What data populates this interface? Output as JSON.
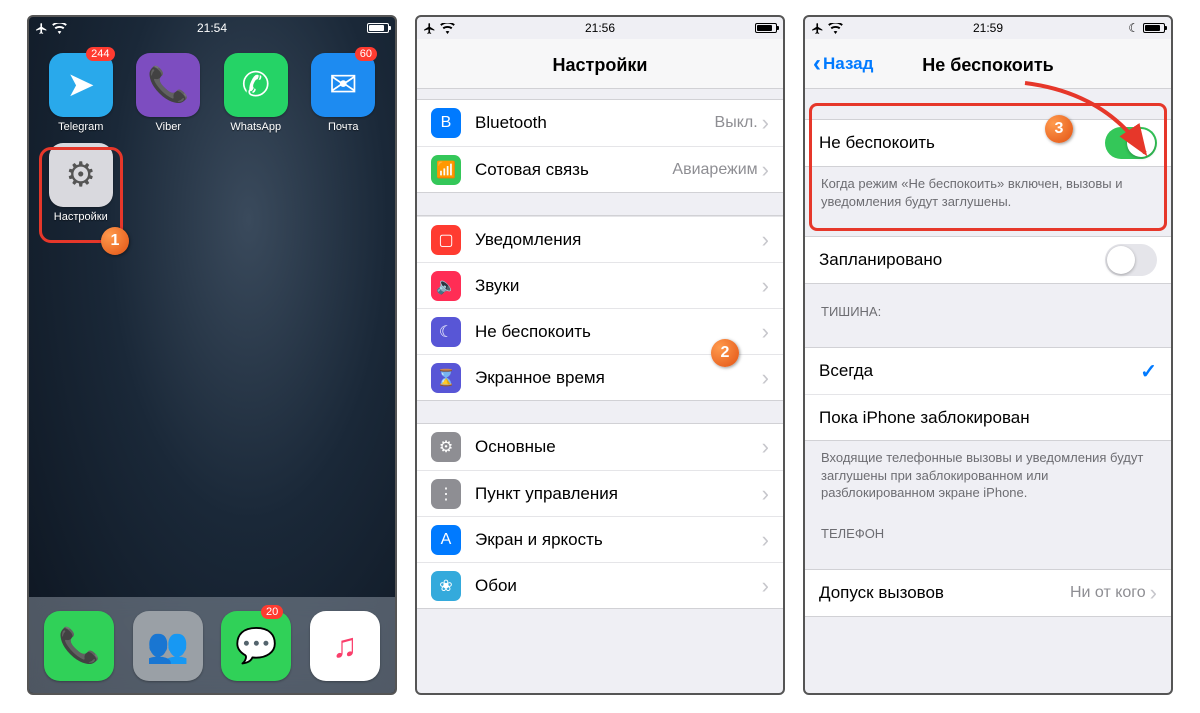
{
  "screen1": {
    "time": "21:54",
    "apps": [
      {
        "name": "telegram",
        "label": "Telegram",
        "badge": "244",
        "bg": "#29a9eb",
        "glyph": "➤"
      },
      {
        "name": "viber",
        "label": "Viber",
        "badge": null,
        "bg": "#7d4dc0",
        "glyph": "📞"
      },
      {
        "name": "whatsapp",
        "label": "WhatsApp",
        "badge": null,
        "bg": "#25d366",
        "glyph": "✆"
      },
      {
        "name": "mail",
        "label": "Почта",
        "badge": "60",
        "bg": "#1d8bf1",
        "glyph": "✉"
      },
      {
        "name": "settings",
        "label": "Настройки",
        "badge": null,
        "bg": "#d9d9de",
        "glyph": "⚙"
      }
    ],
    "dock": [
      {
        "name": "phone",
        "bg": "#30d158",
        "glyph": "📞",
        "badge": null
      },
      {
        "name": "contacts",
        "bg": "#9aa0a6",
        "glyph": "👥",
        "badge": null
      },
      {
        "name": "messages",
        "bg": "#30d158",
        "glyph": "💬",
        "badge": "20"
      },
      {
        "name": "music",
        "bg": "#ffffff",
        "glyph": "♫",
        "badge": null
      }
    ],
    "step": "1"
  },
  "screen2": {
    "time": "21:56",
    "title": "Настройки",
    "group1": [
      {
        "icon_bg": "#007aff",
        "glyph": "B",
        "label": "Bluetooth",
        "value": "Выкл."
      },
      {
        "icon_bg": "#34c759",
        "glyph": "📶",
        "label": "Сотовая связь",
        "value": "Авиарежим"
      }
    ],
    "group2": [
      {
        "icon_bg": "#ff3b30",
        "glyph": "▢",
        "label": "Уведомления"
      },
      {
        "icon_bg": "#ff2d55",
        "glyph": "🔈",
        "label": "Звуки"
      },
      {
        "icon_bg": "#5856d6",
        "glyph": "☾",
        "label": "Не беспокоить"
      },
      {
        "icon_bg": "#5856d6",
        "glyph": "⌛",
        "label": "Экранное время"
      }
    ],
    "group3": [
      {
        "icon_bg": "#8e8e93",
        "glyph": "⚙",
        "label": "Основные"
      },
      {
        "icon_bg": "#8e8e93",
        "glyph": "⋮",
        "label": "Пункт управления"
      },
      {
        "icon_bg": "#007aff",
        "glyph": "A",
        "label": "Экран и яркость"
      },
      {
        "icon_bg": "#34aadc",
        "glyph": "❀",
        "label": "Обои"
      }
    ],
    "step": "2"
  },
  "screen3": {
    "time": "21:59",
    "back": "Назад",
    "title": "Не беспокоить",
    "dnd_label": "Не беспокоить",
    "dnd_footer": "Когда режим «Не беспокоить» включен, вызовы и уведомления будут заглушены.",
    "scheduled_label": "Запланировано",
    "silence_header": "ТИШИНА:",
    "silence_opts": [
      "Всегда",
      "Пока iPhone заблокирован"
    ],
    "silence_footer": "Входящие телефонные вызовы и уведомления будут заглушены при заблокированном или разблокированном экране iPhone.",
    "phone_header": "ТЕЛЕФОН",
    "allow_label": "Допуск вызовов",
    "allow_value": "Ни от кого",
    "step": "3"
  }
}
